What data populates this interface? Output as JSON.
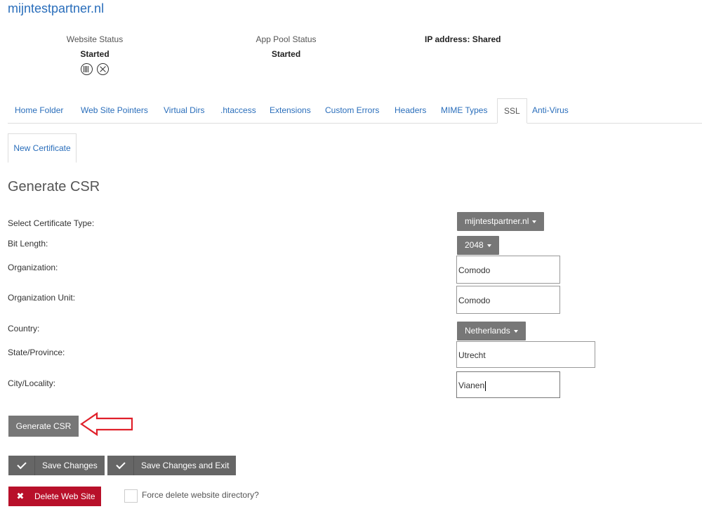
{
  "site": {
    "title": "mijntestpartner.nl"
  },
  "status": {
    "website": {
      "label": "Website Status",
      "value": "Started",
      "icons": [
        "pause-icon",
        "stop-icon"
      ]
    },
    "app_pool": {
      "label": "App Pool Status",
      "value": "Started"
    },
    "ip": {
      "label": "IP address: Shared"
    }
  },
  "tabs": [
    "Home Folder",
    "Web Site Pointers",
    "Virtual Dirs",
    ".htaccess",
    "Extensions",
    "Custom Errors",
    "Headers",
    "MIME Types",
    "SSL",
    "Anti-Virus"
  ],
  "active_tab": "SSL",
  "subtab": "New Certificate",
  "form": {
    "title": "Generate CSR",
    "cert_type": {
      "label": "Select Certificate Type:",
      "value": "mijntestpartner.nl"
    },
    "bit_length": {
      "label": "Bit Length:",
      "value": "2048"
    },
    "organization": {
      "label": "Organization:",
      "value": "Comodo"
    },
    "org_unit": {
      "label": "Organization Unit:",
      "value": "Comodo"
    },
    "country": {
      "label": "Country:",
      "value": "Netherlands"
    },
    "state": {
      "label": "State/Province:",
      "value": "Utrecht"
    },
    "city": {
      "label": "City/Locality:",
      "value": "Vianen"
    },
    "generate_button": "Generate CSR"
  },
  "actions": {
    "save": "Save Changes",
    "save_exit": "Save Changes and Exit",
    "delete": "Delete Web Site",
    "force_delete_label": "Force delete website directory?",
    "force_delete_checked": false
  },
  "colors": {
    "link": "#2a6ebb",
    "button_gray": "#777777",
    "delete_red": "#b8102a",
    "arrow_red": "#e0202a"
  }
}
